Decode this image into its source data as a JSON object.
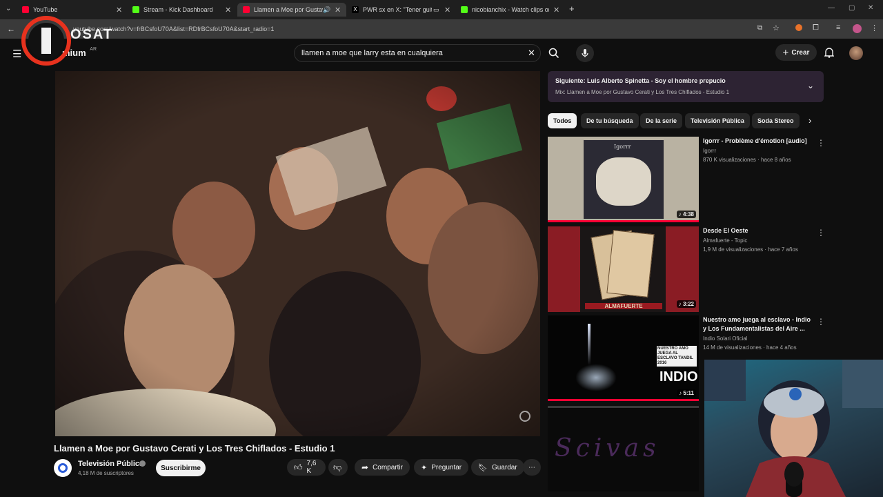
{
  "browser": {
    "tabs": [
      {
        "title": "YouTube",
        "fav": "#ff0033"
      },
      {
        "title": "Stream - Kick Dashboard",
        "fav": "#53fc18"
      },
      {
        "title": "Llamen a Moe por Gustavo",
        "fav": "#ff0033"
      },
      {
        "title": "PWR sx en X: \"Tener guita d",
        "fav": "#000000"
      },
      {
        "title": "nicobianchix - Watch clips on K",
        "fav": "#53fc18"
      }
    ],
    "url": "youtube.com/watch?v=frBCsfoU70A&list=RDfrBCsfoU70A&start_radio=1"
  },
  "header": {
    "logo_text": "mium",
    "region": "AR",
    "search_value": "llamen a moe que larry esta en cualquiera",
    "create_label": "Crear"
  },
  "overlay_logo": "IOSAT",
  "video": {
    "title": "Llamen a Moe por Gustavo Cerati y Los Tres Chiflados - Estudio 1",
    "channel": "Televisión Pública",
    "subscribers": "4,18 M de suscriptores",
    "subscribe_label": "Suscribirme",
    "likes": "7,6 K",
    "share_label": "Compartir",
    "ask_label": "Preguntar",
    "save_label": "Guardar"
  },
  "up_next": {
    "title": "Siguiente: Luis Alberto Spinetta - Soy el hombre prepucio",
    "subtitle": "Mix: Llamen a Moe por Gustavo Cerati y Los Tres Chiflados - Estudio 1"
  },
  "chips": [
    "Todos",
    "De tu búsqueda",
    "De la serie",
    "Televisión Pública",
    "Soda Stereo"
  ],
  "recommendations": [
    {
      "title": "Igorrr - Problème d'émotion [audio]",
      "channel": "Igorrr",
      "meta": "870 K visualizaciones · hace 8 años",
      "duration": "♪ 4:38",
      "thumb_label": "Igorrr"
    },
    {
      "title": "Desde El Oeste",
      "channel": "Almafuerte - Topic",
      "meta": "1,9 M de visualizaciones · hace 7 años",
      "duration": "♪ 3:22",
      "thumb_label": "ALMAFUERTE"
    },
    {
      "title": "Nuestro amo juega al esclavo - Indio y Los Fundamentalistas del Aire ...",
      "channel": "Indio Solari Oficial",
      "meta": "14 M de visualizaciones · hace 4 años",
      "duration": "♪ 5:11",
      "thumb_label": "INDIO",
      "thumb_caption": "NUESTRO AMO JUEGA AL ESCLAVO TANDIL 2016"
    },
    {
      "title": "",
      "channel": "",
      "meta": "",
      "duration": "",
      "thumb_label": "Scivas"
    }
  ]
}
